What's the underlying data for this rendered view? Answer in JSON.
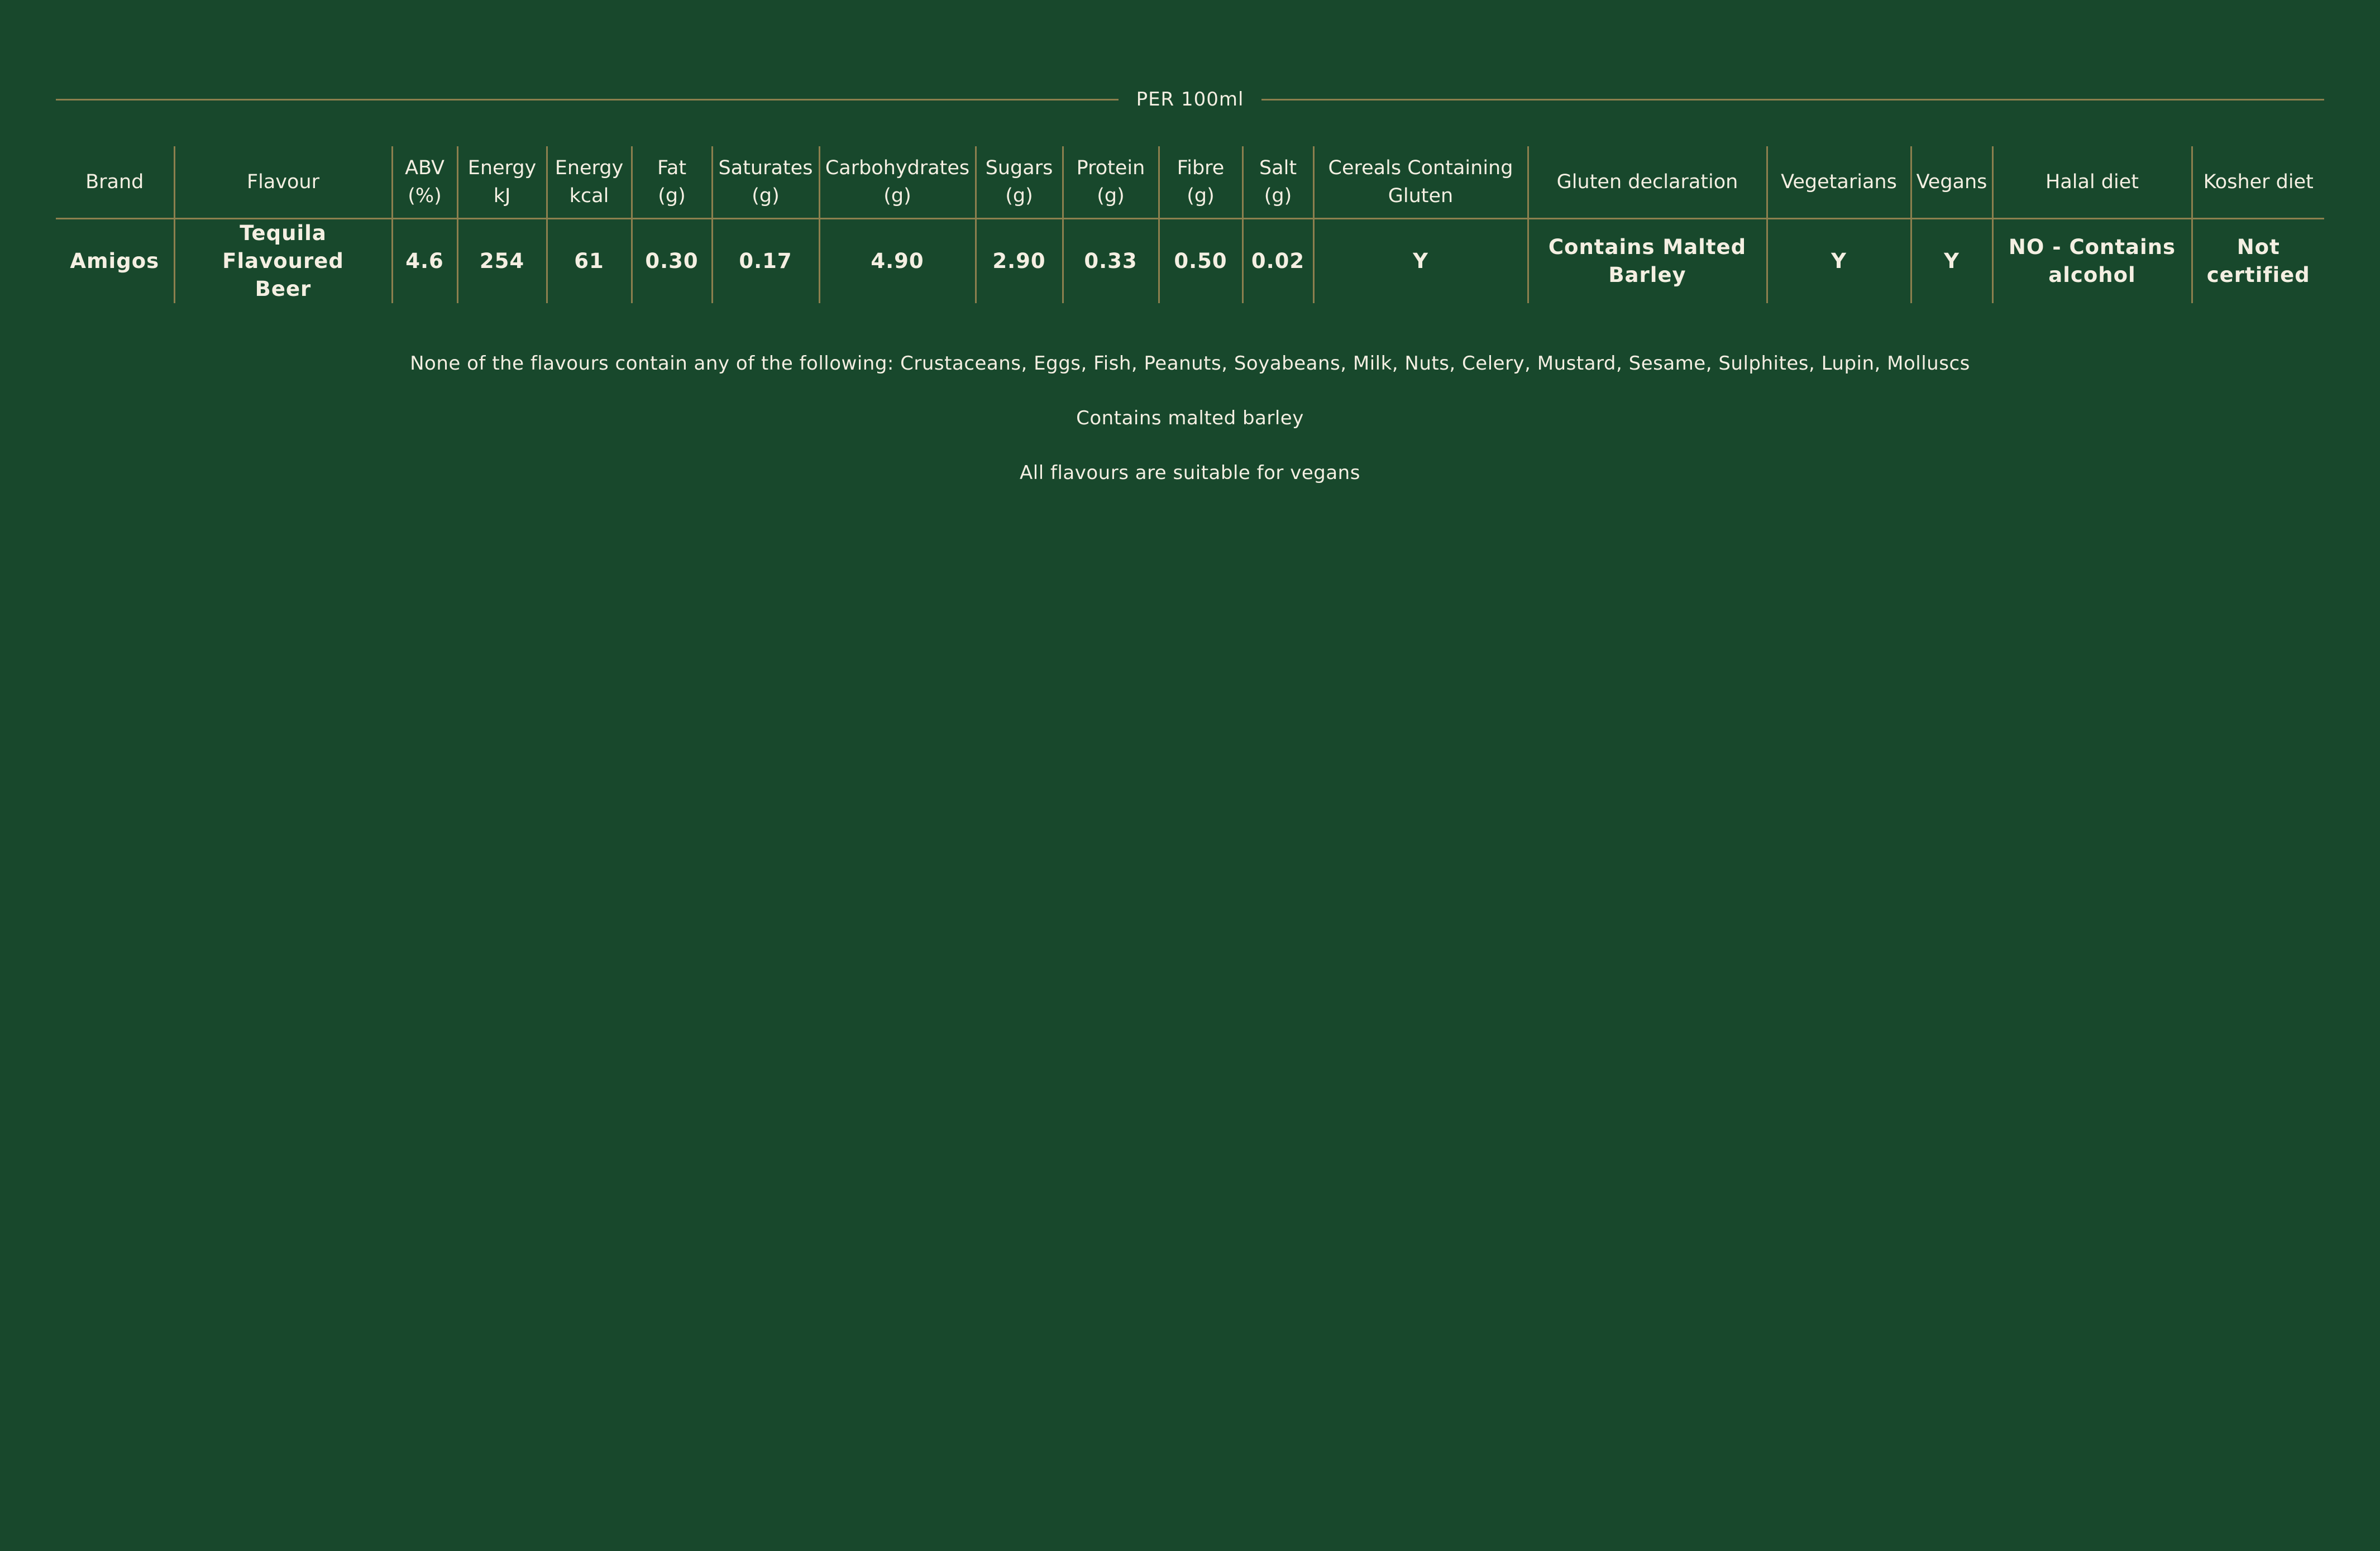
{
  "per_label": "PER 100ml",
  "table": {
    "headers": [
      {
        "line1": "Brand",
        "line2": ""
      },
      {
        "line1": "Flavour",
        "line2": ""
      },
      {
        "line1": "ABV",
        "line2": "(%)"
      },
      {
        "line1": "Energy",
        "line2": "kJ"
      },
      {
        "line1": "Energy",
        "line2": "kcal"
      },
      {
        "line1": "Fat",
        "line2": "(g)"
      },
      {
        "line1": "Saturates",
        "line2": "(g)"
      },
      {
        "line1": "Carbohydrates",
        "line2": "(g)"
      },
      {
        "line1": "Sugars",
        "line2": "(g)"
      },
      {
        "line1": "Protein",
        "line2": "(g)"
      },
      {
        "line1": "Fibre",
        "line2": "(g)"
      },
      {
        "line1": "Salt",
        "line2": "(g)"
      },
      {
        "line1": "Cereals Containing",
        "line2": "Gluten"
      },
      {
        "line1": "Gluten declaration",
        "line2": ""
      },
      {
        "line1": "Vegetarians",
        "line2": ""
      },
      {
        "line1": "Vegans",
        "line2": ""
      },
      {
        "line1": "Halal diet",
        "line2": ""
      },
      {
        "line1": "Kosher diet",
        "line2": ""
      }
    ],
    "row": [
      {
        "line1": "Amigos",
        "line2": ""
      },
      {
        "line1": "Tequila Flavoured",
        "line2": "Beer"
      },
      {
        "line1": "4.6",
        "line2": ""
      },
      {
        "line1": "254",
        "line2": ""
      },
      {
        "line1": "61",
        "line2": ""
      },
      {
        "line1": "0.30",
        "line2": ""
      },
      {
        "line1": "0.17",
        "line2": ""
      },
      {
        "line1": "4.90",
        "line2": ""
      },
      {
        "line1": "2.90",
        "line2": ""
      },
      {
        "line1": "0.33",
        "line2": ""
      },
      {
        "line1": "0.50",
        "line2": ""
      },
      {
        "line1": "0.02",
        "line2": ""
      },
      {
        "line1": "Y",
        "line2": ""
      },
      {
        "line1": "Contains Malted",
        "line2": "Barley"
      },
      {
        "line1": "Y",
        "line2": ""
      },
      {
        "line1": "Y",
        "line2": ""
      },
      {
        "line1": "NO - Contains",
        "line2": "alcohol"
      },
      {
        "line1": "Not",
        "line2": "certified"
      }
    ]
  },
  "notes": {
    "allergens": "None of the flavours contain any of the following: Crustaceans, Eggs, Fish, Peanuts, Soyabeans, Milk, Nuts, Celery, Mustard, Sesame, Sulphites, Lupin, Molluscs",
    "barley": "Contains malted barley",
    "vegans": "All flavours are suitable for vegans"
  },
  "colors": {
    "background": "#18482c",
    "rule": "#8c7f4e",
    "text": "#f4efe2"
  }
}
